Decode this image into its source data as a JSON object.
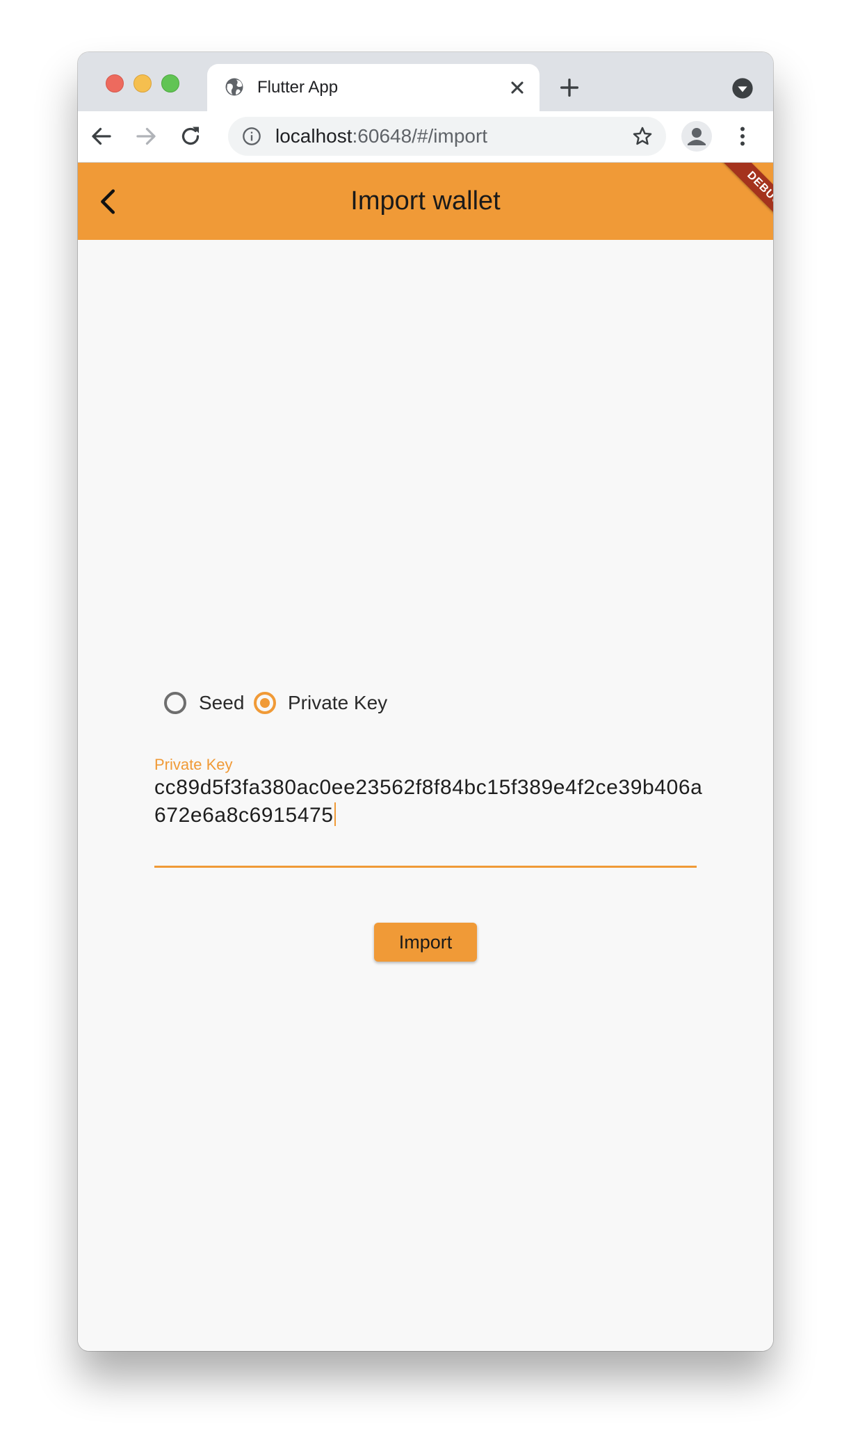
{
  "browser": {
    "tab_title": "Flutter App",
    "url_host": "localhost",
    "url_rest": ":60648/#/import"
  },
  "app": {
    "title": "Import wallet",
    "debug_banner": "DEBUG",
    "accent_color": "#f09a37"
  },
  "import_form": {
    "options": [
      {
        "label": "Seed",
        "selected": false
      },
      {
        "label": "Private Key",
        "selected": true
      }
    ],
    "field_label": "Private Key",
    "field_value": "cc89d5f3fa380ac0ee23562f8f84bc15f389e4f2ce39b406a672e6a8c6915475",
    "submit_label": "Import"
  }
}
